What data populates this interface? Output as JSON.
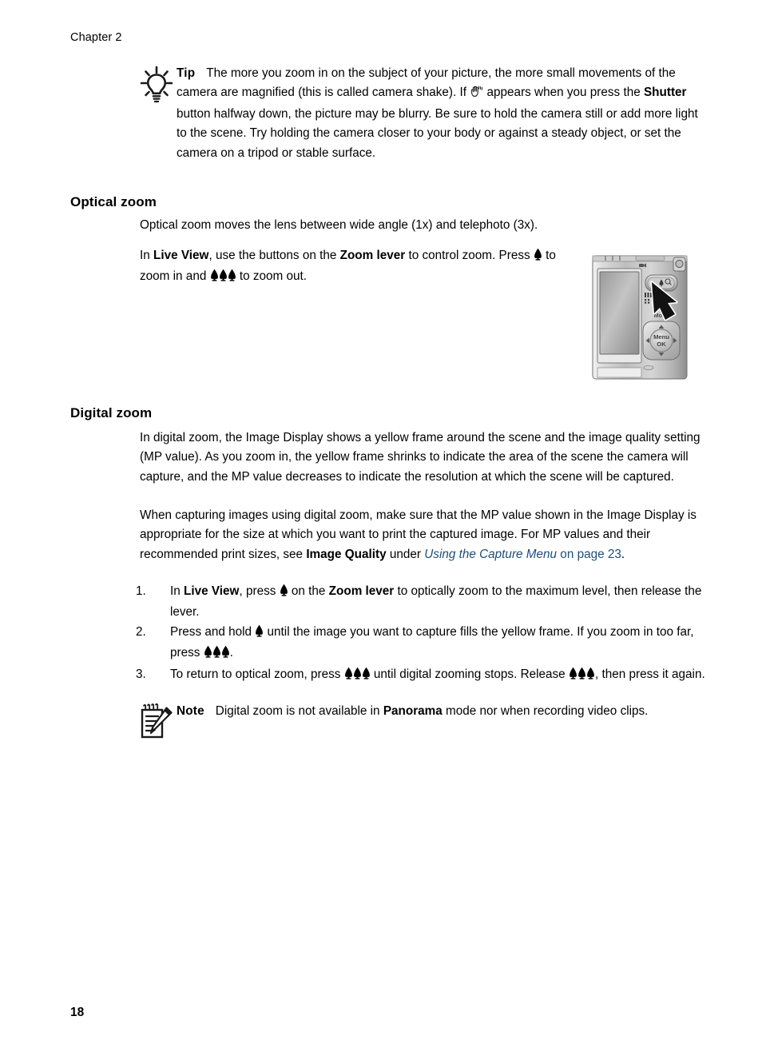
{
  "document": {
    "chapter_header": "Chapter 2",
    "page_number": "18"
  },
  "tip_callout": {
    "icon": "lightbulb-icon",
    "label": "Tip",
    "text_part_1": "The more you zoom in on the subject of your picture, the more small movements of the camera are magnified (this is called camera shake). If ",
    "inline_icon": "shaking-hand-icon",
    "text_part_2": " appears when you press the ",
    "bold_1": "Shutter",
    "text_part_3": " button halfway down, the picture may be blurry. Be sure to hold the camera still or add more light to the scene. Try holding the camera closer to your body or against a steady object, or set the camera on a tripod or stable surface."
  },
  "optical_zoom": {
    "heading": "Optical zoom",
    "paragraph_1": "Optical zoom moves the lens between wide angle (1x) and telephoto (3x).",
    "paragraph_2": {
      "t1": "In ",
      "b1": "Live View",
      "t2": ", use the buttons on the ",
      "b2": "Zoom lever",
      "t3": " to control zoom. Press ",
      "icon_tele": "telephoto-zoom-icon",
      "t4": " to zoom in and ",
      "icon_wide": "wide-angle-zoom-icon",
      "t5": " to zoom out."
    }
  },
  "camera_illustration": {
    "name": "camera-back-illustration",
    "mode_label": "Mode",
    "menu_label": "Menu",
    "ok_label": "OK",
    "callout_arrow": "zoom-lever-pointer-arrow"
  },
  "digital_zoom": {
    "heading": "Digital zoom",
    "paragraph_1": "In digital zoom, the Image Display shows a yellow frame around the scene and the image quality setting (MP value). As you zoom in, the yellow frame shrinks to indicate the area of the scene the camera will capture, and the MP value decreases to indicate the resolution at which the scene will be captured.",
    "paragraph_2": {
      "t1": "When capturing images using digital zoom, make sure that the MP value shown in the Image Display is appropriate for the size at which you want to print the captured image. For MP values and their recommended print sizes, see ",
      "b1": "Image Quality",
      "t2": " under ",
      "link": "Using the Capture Menu",
      "link_suffix": " on page 23",
      "t3": "."
    },
    "steps": [
      {
        "number": "1.",
        "t1": "In ",
        "b1": "Live View",
        "t2": ", press ",
        "icon1": "telephoto-zoom-icon",
        "t3": " on the ",
        "b2": "Zoom lever",
        "t4": " to optically zoom to the maximum level, then release the lever."
      },
      {
        "number": "2.",
        "t1": "Press and hold ",
        "icon1": "telephoto-zoom-icon",
        "t2": " until the image you want to capture fills the yellow frame. If you zoom in too far, press ",
        "icon2": "wide-angle-zoom-icon",
        "t3": "."
      },
      {
        "number": "3.",
        "t1": "To return to optical zoom, press ",
        "icon1": "wide-angle-zoom-icon",
        "t2": " until digital zooming stops. Release ",
        "icon2": "wide-angle-zoom-icon",
        "t3": ", then press it again."
      }
    ]
  },
  "note_callout": {
    "icon": "notepad-pencil-icon",
    "label": "Note",
    "t1": "Digital zoom is not available in ",
    "b1": "Panorama",
    "t2": " mode nor when recording video clips."
  },
  "colors": {
    "link": "#1F4E79",
    "text": "#000000",
    "background": "#ffffff"
  }
}
